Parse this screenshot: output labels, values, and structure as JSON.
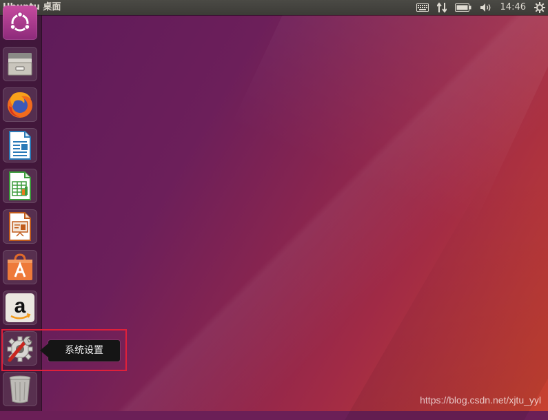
{
  "top_panel": {
    "title": "Ubuntu 桌面",
    "clock": "14:46",
    "indicators": [
      "keyboard-icon",
      "network-icon",
      "battery-icon",
      "volume-icon",
      "gear-icon"
    ]
  },
  "launcher": {
    "items": [
      {
        "name": "ubuntu-dash",
        "icon": "ubuntu-logo-icon"
      },
      {
        "name": "files",
        "icon": "file-cabinet-icon"
      },
      {
        "name": "firefox",
        "icon": "firefox-icon"
      },
      {
        "name": "writer",
        "icon": "writer-document-icon"
      },
      {
        "name": "calc",
        "icon": "calc-spreadsheet-icon"
      },
      {
        "name": "impress",
        "icon": "impress-presentation-icon"
      },
      {
        "name": "software",
        "icon": "shopping-bag-icon"
      },
      {
        "name": "amazon",
        "icon": "amazon-icon"
      },
      {
        "name": "system-settings",
        "icon": "settings-gear-wrench-icon"
      },
      {
        "name": "trash",
        "icon": "trash-icon"
      }
    ]
  },
  "tooltip": {
    "label": "系统设置"
  },
  "watermark": {
    "text": "https://blog.csdn.net/xjtu_yyl"
  },
  "colors": {
    "highlight_border": "#e0203a",
    "panel_bg": "#3c3b37"
  }
}
